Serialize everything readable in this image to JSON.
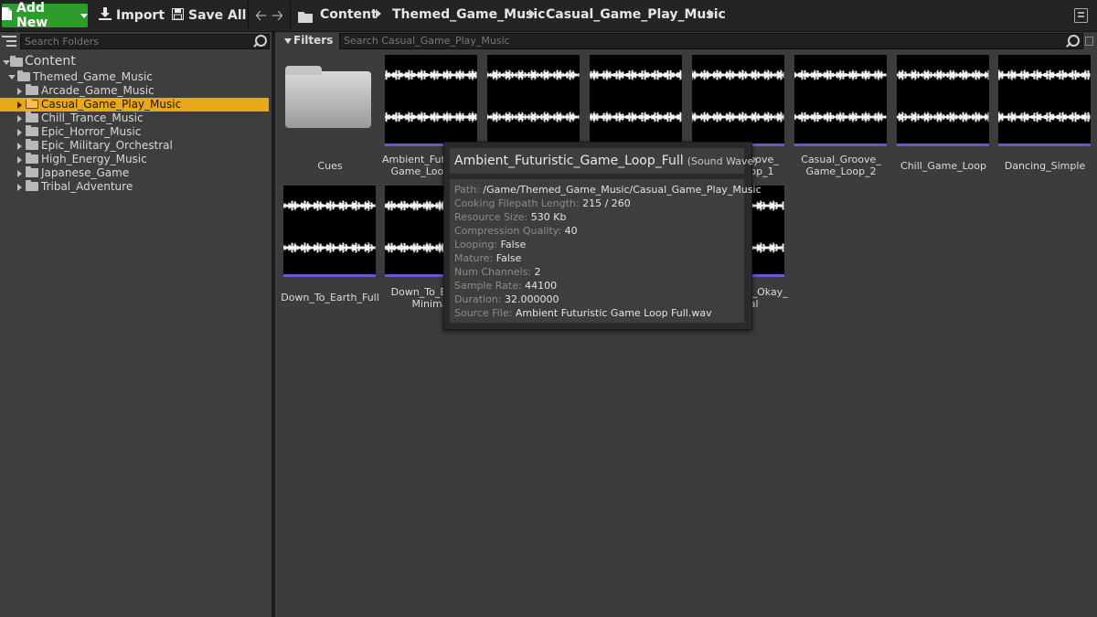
{
  "toolbar": {
    "add_new": "Add New",
    "import": "Import",
    "save_all": "Save All"
  },
  "breadcrumb": [
    "Content",
    "Themed_Game_Music",
    "Casual_Game_Play_Music"
  ],
  "left_panel": {
    "search_placeholder": "Search Folders",
    "root": "Content",
    "themed": "Themed_Game_Music",
    "folders": [
      "Arcade_Game_Music",
      "Casual_Game_Play_Music",
      "Chill_Trance_Music",
      "Epic_Horror_Music",
      "Epic_Military_Orchestral",
      "High_Energy_Music",
      "Japanese_Game",
      "Tribal_Adventure"
    ],
    "selected_folder": "Casual_Game_Play_Music"
  },
  "right_panel": {
    "filters_label": "Filters",
    "search_placeholder": "Search Casual_Game_Play_Music",
    "row1": [
      {
        "label": "Cues",
        "kind": "folder"
      },
      {
        "label": "Ambient_Futuristic_\nGame_Loop_Full",
        "kind": "sound"
      },
      {
        "label": "",
        "kind": "sound"
      },
      {
        "label": "",
        "kind": "sound"
      },
      {
        "label": "Casual_Groove_\nGame_Loop_1",
        "kind": "sound"
      },
      {
        "label": "Casual_Groove_\nGame_Loop_2",
        "kind": "sound"
      },
      {
        "label": "Chill_Game_Loop",
        "kind": "sound"
      },
      {
        "label": "Dancing_Simple",
        "kind": "sound"
      }
    ],
    "row2": [
      {
        "label": "Down_To_Earth_Full",
        "kind": "sound"
      },
      {
        "label": "Down_To_Earth_\nMinimal",
        "kind": "sound"
      },
      {
        "label": "",
        "kind": "sound"
      },
      {
        "label": "",
        "kind": "sound"
      },
      {
        "label": "Everything's_Okay_\nMinimal",
        "kind": "sound"
      }
    ]
  },
  "tooltip": {
    "name": "Ambient_Futuristic_Game_Loop_Full",
    "type": "(Sound Wave)",
    "rows": [
      {
        "key": "Path:",
        "val": "/Game/Themed_Game_Music/Casual_Game_Play_Music"
      },
      {
        "key": "Cooking Filepath Length:",
        "val": "215 / 260"
      },
      {
        "key": "Resource Size:",
        "val": "530 Kb"
      },
      {
        "key": "Compression Quality:",
        "val": "40"
      },
      {
        "key": "Looping:",
        "val": "False"
      },
      {
        "key": "Mature:",
        "val": "False"
      },
      {
        "key": "Num Channels:",
        "val": "2"
      },
      {
        "key": "Sample Rate:",
        "val": "44100"
      },
      {
        "key": "Duration:",
        "val": "32.000000"
      },
      {
        "key": "Source File:",
        "val": "Ambient Futuristic Game Loop Full.wav"
      }
    ]
  },
  "colors": {
    "accent_green": "#2e9c2c",
    "selection_orange": "#e8a818",
    "sound_wave_bar": "#6a5acd"
  }
}
